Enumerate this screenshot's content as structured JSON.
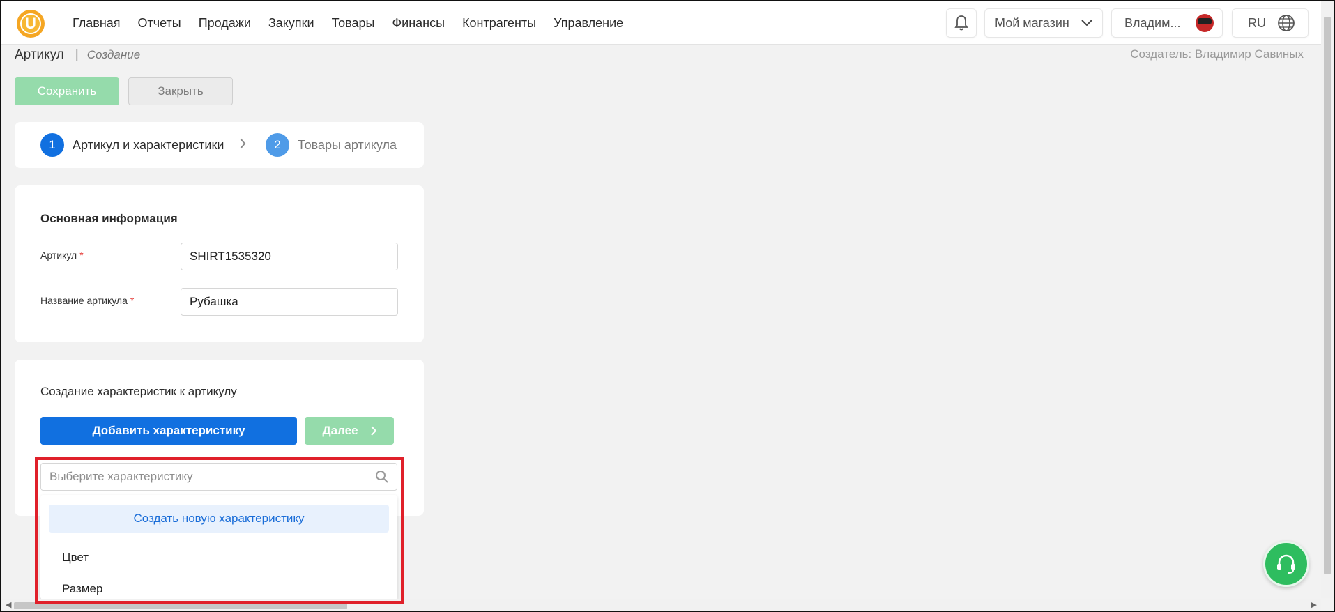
{
  "nav": {
    "logo_letter": "U",
    "items": [
      "Главная",
      "Отчеты",
      "Продажи",
      "Закупки",
      "Товары",
      "Финансы",
      "Контрагенты",
      "Управление"
    ],
    "store_label": "Мой магазин",
    "user_label": "Владим...",
    "lang_label": "RU"
  },
  "header": {
    "title": "Артикул",
    "separator": "|",
    "mode": "Создание",
    "creator": "Создатель: Владимир Савиных"
  },
  "actions": {
    "save_label": "Сохранить",
    "close_label": "Закрыть"
  },
  "steps": {
    "step1_num": "1",
    "step1_label": "Артикул и характеристики",
    "step2_num": "2",
    "step2_label": "Товары артикула"
  },
  "main_info": {
    "title": "Основная информация",
    "article_label": "Артикул",
    "article_value": "SHIRT1535320",
    "name_label": "Название артикула",
    "name_value": "Рубашка",
    "required_mark": "*"
  },
  "characteristics": {
    "title": "Создание характеристик к артикулу",
    "add_label": "Добавить характеристику",
    "next_label": "Далее",
    "search_placeholder": "Выберите характеристику",
    "create_new_label": "Создать новую характеристику",
    "options": [
      "Цвет",
      "Размер"
    ]
  },
  "colors": {
    "primary": "#1170e0",
    "success_disabled": "#95dbab",
    "highlight": "#e0202a",
    "support": "#2ebd5f",
    "logo": "#f5a623"
  }
}
